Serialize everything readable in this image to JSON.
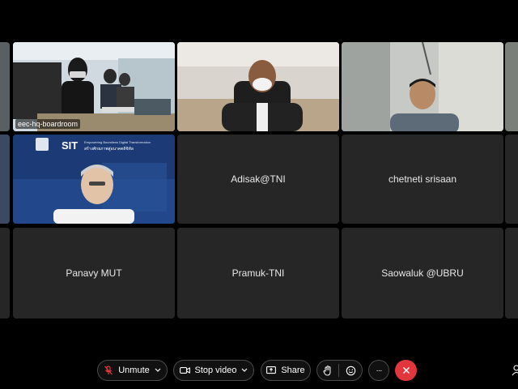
{
  "tiles": {
    "t1": {
      "label": "eec-hq-boardroom"
    },
    "t4": {
      "slide_logo": "SIT",
      "slide_line1": "Empowering Boundless Digital Transformation",
      "slide_line2": "สร้างศักยภาพสู่อนาคตดิจิทัล"
    },
    "t5": {
      "name": "Adisak@TNI"
    },
    "t6": {
      "name": "chetneti srisaan"
    },
    "t7": {
      "name": "Panavy MUT"
    },
    "t8": {
      "name": "Pramuk-TNI"
    },
    "t9": {
      "name": "Saowaluk @UBRU"
    }
  },
  "controls": {
    "unmute_label": "Unmute",
    "stop_video_label": "Stop video",
    "share_label": "Share",
    "more_label": "···"
  },
  "colors": {
    "tile_bg": "#262626",
    "active_border": "#4a90d9",
    "end_call": "#e2363d"
  }
}
